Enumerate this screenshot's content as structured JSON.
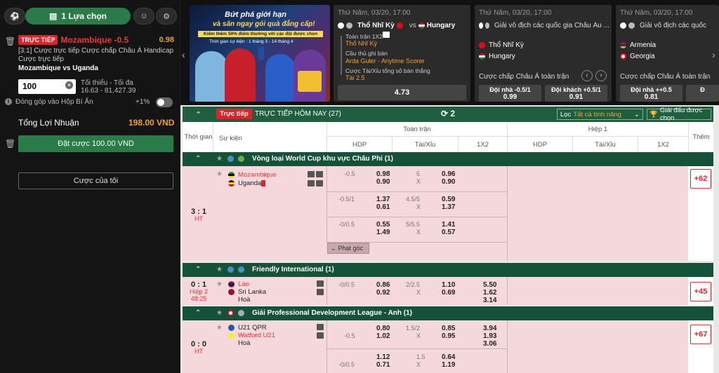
{
  "betslip": {
    "tab_label": "1 Lựa chọn",
    "live_tag": "TRỰC TIẾP",
    "team_selected": "Mozambique -0.5",
    "odds": "0.98",
    "market_line1": "[3:1] Cược trực tiếp Cược chấp Châu Á Handicap",
    "market_line2": "Cược trực tiếp",
    "match": "Mozambique vs Uganda",
    "stake_value": "100",
    "min_max_label": "Tối thiểu - Tối đa",
    "min_max_value": "16.63 - 81,427.39",
    "contribute_label": "Đóng góp vào Hộp Bí Ẩn",
    "contribute_value": "+1%",
    "total_profit_label": "Tổng Lợi Nhuận",
    "total_profit_value": "198.00 VND",
    "place_bet_label": "Đặt cược 100.00 VND",
    "my_bets_label": "Cược của tôi"
  },
  "promo": {
    "title1": "Bứt phá giới hạn",
    "title2": "và săn ngay gói quà đẳng cấp!",
    "sub": "Kiếm thêm 50% điểm thưởng với các đội được chọn",
    "date": "Thời gian sự kiện : 1 tháng 3 - 14 tháng 4"
  },
  "cards": [
    {
      "header": "Thứ Năm, 03/20, 17:00",
      "team_a": "Thổ Nhĩ Kỳ",
      "vs": "vs",
      "team_b": "Hungary",
      "line1": "Toàn trận 1X2",
      "line1_val": "Thổ Nhĩ Kỳ",
      "line2": "Cầu thủ ghi bàn",
      "line2_val": "Arda Guler - Anytime Scorer",
      "line3": "Cược Tài/Xỉu tổng số bàn thắng",
      "line3_val": "Tài 2.5",
      "odds": "4.73"
    },
    {
      "header": "Thứ Năm, 03/20, 17:00",
      "league": "Giải vô địch các quốc gia Châu Âu ...",
      "team_a": "Thổ Nhĩ Kỳ",
      "team_b": "Hungary",
      "market": "Cược chấp Châu Á toàn trận",
      "home_label": "Đội nhà -0.5/1",
      "home_odds": "0.99",
      "away_label": "Đội khách +0.5/1",
      "away_odds": "0.91"
    },
    {
      "header": "Thứ Năm, 03/20, 17:00",
      "league": "Giải vô địch các quốc",
      "team_a": "Armenia",
      "team_b": "Georgia",
      "market": "Cược chấp Châu Á toàn trận",
      "home_label": "Đội nhà ++0.5",
      "home_odds": "0.81",
      "away_label": "Đ"
    }
  ],
  "toolbar": {
    "live_tag": "Trực tiếp",
    "title": "TRỰC TIẾP HÔM NAY (27)",
    "refresh_count": "2",
    "filter_label": "Lọc",
    "filter_value": "Tất cả tính năng",
    "featured_label": "Giải đấu được chọn"
  },
  "headers": {
    "time": "Thời gian",
    "event": "Sự kiện",
    "full_time": "Toàn trận",
    "half_1": "Hiệp 1",
    "more": "Thêm",
    "hdp": "HDP",
    "ou": "Tài/Xỉu",
    "x12": "1X2"
  },
  "leagues": [
    {
      "name": "Vòng loại World Cup khu vực Châu Phi (1)",
      "match": {
        "score": "3 : 1",
        "period": "HT",
        "home": "Mozambique",
        "away": "Uganda",
        "more": "+62",
        "rows": [
          {
            "hdp": "-0.5",
            "h1": "0.98",
            "h2": "0.90",
            "ou": "5",
            "ou2": "X",
            "o1": "0.96",
            "o2": "0.90"
          },
          {
            "hdp": "-0.5/1",
            "h1": "1.37",
            "h2": "0.61",
            "ou": "4.5/5",
            "ou2": "X",
            "o1": "0.59",
            "o2": "1.37"
          },
          {
            "hdp": "-0/0.5",
            "h1": "0.55",
            "h2": "1.49",
            "ou": "5/5.5",
            "ou2": "X",
            "o1": "1.41",
            "o2": "0.57"
          }
        ],
        "corner_label": "Phạt góc"
      }
    },
    {
      "name": "Friendly International (1)",
      "match": {
        "score": "0 : 1",
        "period": "Hiệp 2",
        "clock": "48:25",
        "home": "Lào",
        "away": "Sri Lanka",
        "draw": "Hoà",
        "more": "+45",
        "rows": [
          {
            "hdp": "-0/0.5",
            "h1": "0.86",
            "h2": "0.92",
            "ou": "2/2.5",
            "ou2": "X",
            "o1": "1.10",
            "o2": "0.69",
            "x1": "5.50",
            "x2": "1.62",
            "x3": "3.14"
          }
        ]
      }
    },
    {
      "name": "Giải Professional Development League - Anh (1)",
      "match": {
        "score": "0 : 0",
        "period": "HT",
        "home": "U21 QPR",
        "away": "Watford U21",
        "draw": "Hoà",
        "more": "+67",
        "rows": [
          {
            "hdp": "-0.5",
            "h1": "0.80",
            "h2": "1.02",
            "ou": "1.5/2",
            "ou2": "X",
            "o1": "0.85",
            "o2": "0.95",
            "x1": "3.94",
            "x2": "1.93",
            "x3": "3.06"
          },
          {
            "hdp": "-0/0.5",
            "h1": "1.12",
            "h2": "0.71",
            "ou": "1.5",
            "ou2": "X",
            "o1": "0.64",
            "o2": "1.19"
          }
        ]
      }
    }
  ],
  "colors": {
    "accent_green": "#2a7a4a",
    "live_red": "#d8262f",
    "row_pink": "#f4d8db",
    "league_green": "#15523a"
  }
}
